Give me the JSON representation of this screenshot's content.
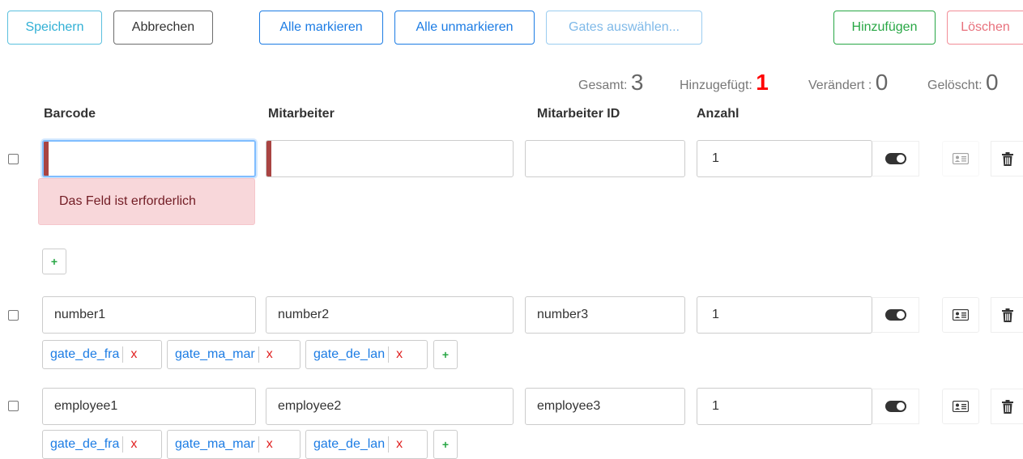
{
  "toolbar": {
    "save": "Speichern",
    "cancel": "Abbrechen",
    "select_all": "Alle markieren",
    "deselect_all": "Alle unmarkieren",
    "select_gates": "Gates auswählen...",
    "add": "Hinzufügen",
    "delete": "Löschen"
  },
  "stats": {
    "total_label": "Gesamt:",
    "total_value": "3",
    "added_label": "Hinzugefügt:",
    "added_value": "1",
    "changed_label": "Verändert :",
    "changed_value": "0",
    "deleted_label": "Gelöscht:",
    "deleted_value": "0"
  },
  "columns": {
    "barcode": "Barcode",
    "employee": "Mitarbeiter",
    "employee_id": "Mitarbeiter ID",
    "count": "Anzahl"
  },
  "rows": [
    {
      "barcode": "",
      "employee": "",
      "employee_id": "",
      "count": "1",
      "error": "Das Feld ist erforderlich",
      "add_gate": "+"
    },
    {
      "barcode": "number1",
      "employee": "number2",
      "employee_id": "number3",
      "count": "1",
      "gates": [
        "gate_de_fra",
        "gate_ma_mar",
        "gate_de_lan"
      ],
      "remove_label": "x",
      "add_gate": "+"
    },
    {
      "barcode": "employee1",
      "employee": "employee2",
      "employee_id": "employee3",
      "count": "1",
      "gates": [
        "gate_de_fra",
        "gate_ma_mar",
        "gate_de_lan"
      ],
      "remove_label": "x",
      "add_gate": "+"
    }
  ],
  "colors": {
    "required_marker": "#a94442",
    "added_count": "#ff0000",
    "gate_link": "#1c7ce4",
    "remove_x": "#e02020",
    "add_plus": "#28a745"
  },
  "icons": {
    "toggle": "toggle-icon",
    "card": "id-card-icon",
    "trash": "trash-icon"
  }
}
